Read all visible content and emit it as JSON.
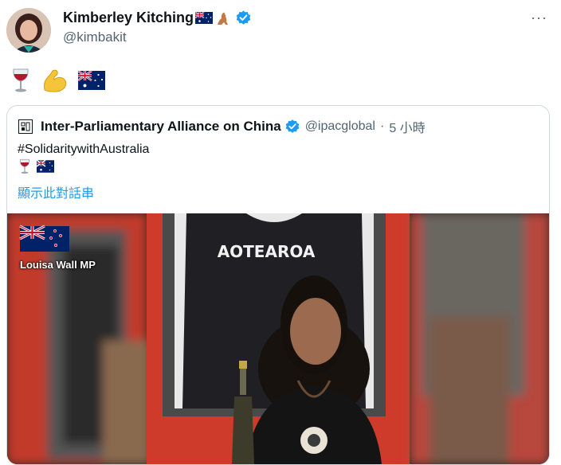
{
  "tweet": {
    "author_name": "Kimberley Kitching",
    "author_flag_emoji": "🇦🇺",
    "author_kangaroo_emoji": "🦘",
    "author_handle": "@kimbakit",
    "more_glyph": "···",
    "body_emojis": [
      "🍷",
      "💪",
      "🇦🇺"
    ],
    "verified_icon": "verified-badge-icon"
  },
  "quoted": {
    "author_name": "Inter-Parliamentary Alliance on China",
    "author_handle": "@ipacglobal",
    "separator": "·",
    "time": "5 小時",
    "hashtag_text": "#SolidaritywithAustralia",
    "emojis": [
      "🍷",
      "🇦🇺"
    ],
    "thread_link": "顯示此對話串",
    "logo_icon": "ipac-logo-icon"
  },
  "video": {
    "overlay_label": "Louisa Wall MP",
    "flag_icon": "new-zealand-flag-icon",
    "jersey_text": "AOTEAROA"
  },
  "colors": {
    "link": "#1d9bf0",
    "secondary_text": "#536471",
    "verified": "#1d9bf0",
    "border": "#cfd9de"
  }
}
